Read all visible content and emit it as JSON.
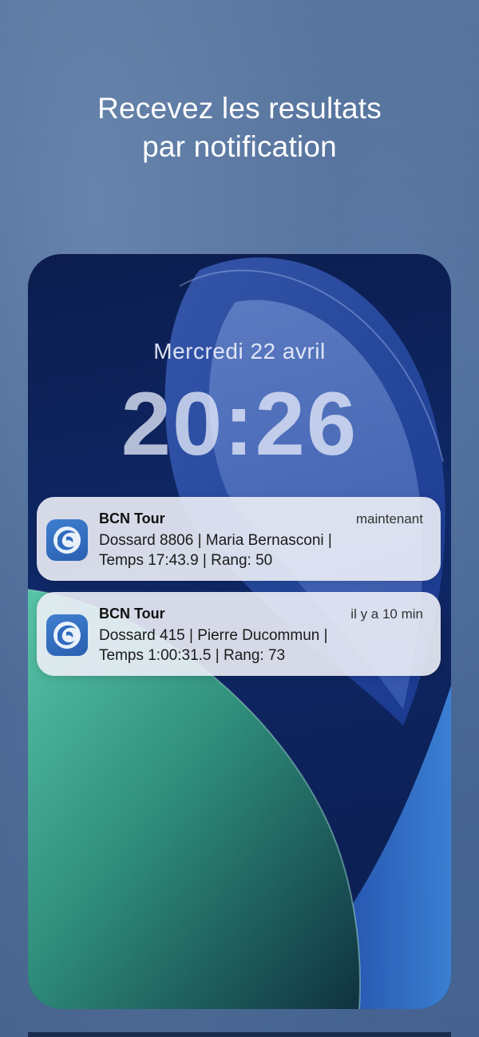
{
  "headline": {
    "line1": "Recevez les resultats",
    "line2": "par notification"
  },
  "lockscreen": {
    "date": "Mercredi 22 avril",
    "time": "20:26"
  },
  "notifications": [
    {
      "app": "BCN Tour",
      "time": "maintenant",
      "line1": "Dossard 8806 | Maria Bernasconi |",
      "line2": "Temps 17:43.9 | Rang: 50",
      "icon": "bcn-tour-swirl-icon"
    },
    {
      "app": "BCN Tour",
      "time": "il y a 10 min",
      "line1": "Dossard 415 | Pierre Ducommun |",
      "line2": "Temps 1:00:31.5 | Rang: 73",
      "icon": "bcn-tour-swirl-icon"
    }
  ],
  "colors": {
    "background": "#4a6690",
    "wallpaper_blue": "#0f2867",
    "wallpaper_green": "#3fae95",
    "app_icon": "#2f6cc0"
  }
}
